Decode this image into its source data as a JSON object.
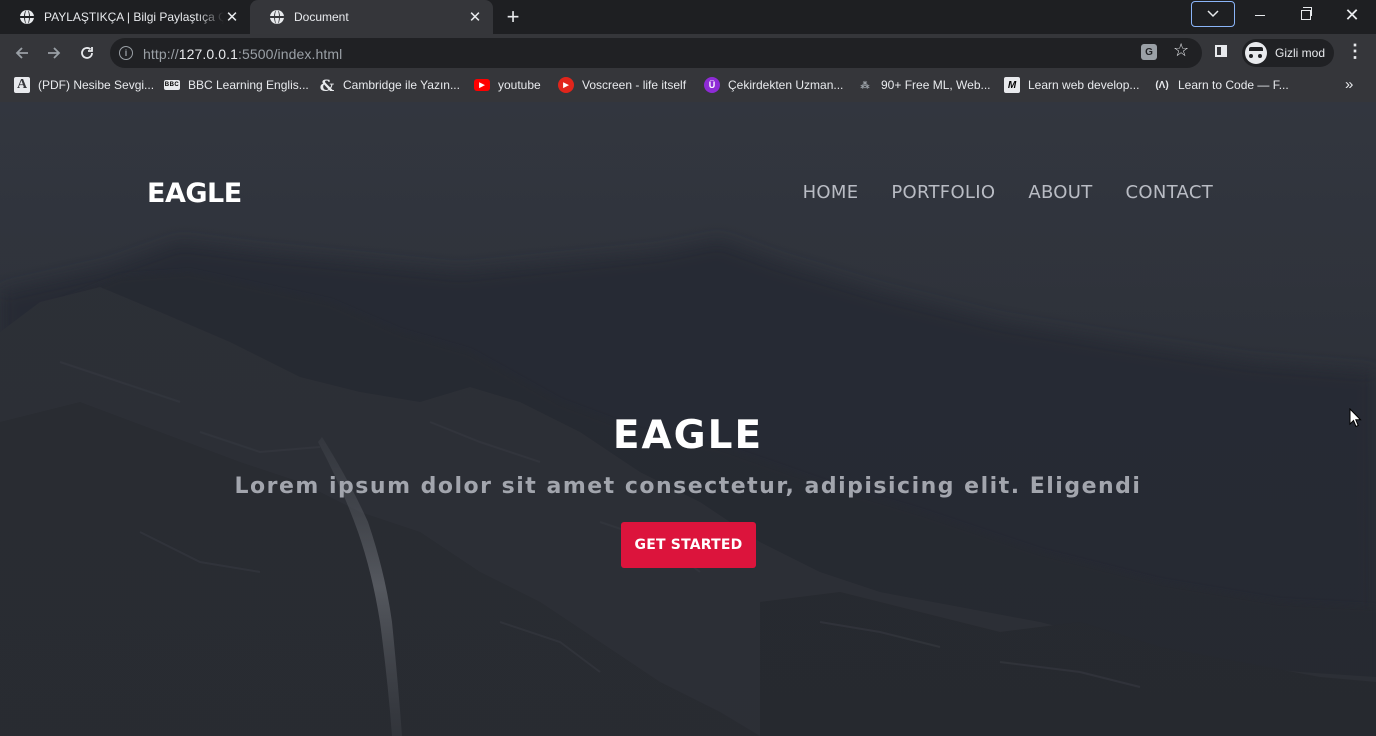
{
  "browser": {
    "tabs": [
      {
        "title": "PAYLAŞTIKÇA | Bilgi Paylaştıça Ço",
        "active": false
      },
      {
        "title": "Document",
        "active": true
      }
    ],
    "url_prefix": "http://",
    "url_host": "127.0.0.1",
    "url_rest": ":5500/index.html",
    "incognito_label": "Gizli mod",
    "bookmarks": [
      {
        "label": "(PDF) Nesibe Sevgi...",
        "icon": "academia-icon"
      },
      {
        "label": "BBC Learning Englis...",
        "icon": "bbc-icon"
      },
      {
        "label": "Cambridge ile Yazın...",
        "icon": "ampersand-icon"
      },
      {
        "label": "youtube",
        "icon": "youtube-icon"
      },
      {
        "label": "Voscreen - life itself",
        "icon": "voscreen-icon"
      },
      {
        "label": "Çekirdekten Uzman...",
        "icon": "udemy-icon"
      },
      {
        "label": "90+ Free ML, Web...",
        "icon": "ml-icon"
      },
      {
        "label": "Learn web develop...",
        "icon": "mdn-icon"
      },
      {
        "label": "Learn to Code — F...",
        "icon": "freecodecamp-icon"
      }
    ]
  },
  "page": {
    "logo": "EAGLE",
    "nav": [
      "HOME",
      "PORTFOLIO",
      "ABOUT",
      "CONTACT"
    ],
    "hero_title": "EAGLE",
    "hero_subtitle": "Lorem ipsum dolor sit amet consectetur, adipisicing elit. Eligendi",
    "cta_label": "GET STARTED"
  },
  "colors": {
    "cta": "#dc143c",
    "chrome_dark": "#1e1f22",
    "chrome_toolbar": "#35363a",
    "nav_text": "#b9bcc4"
  }
}
